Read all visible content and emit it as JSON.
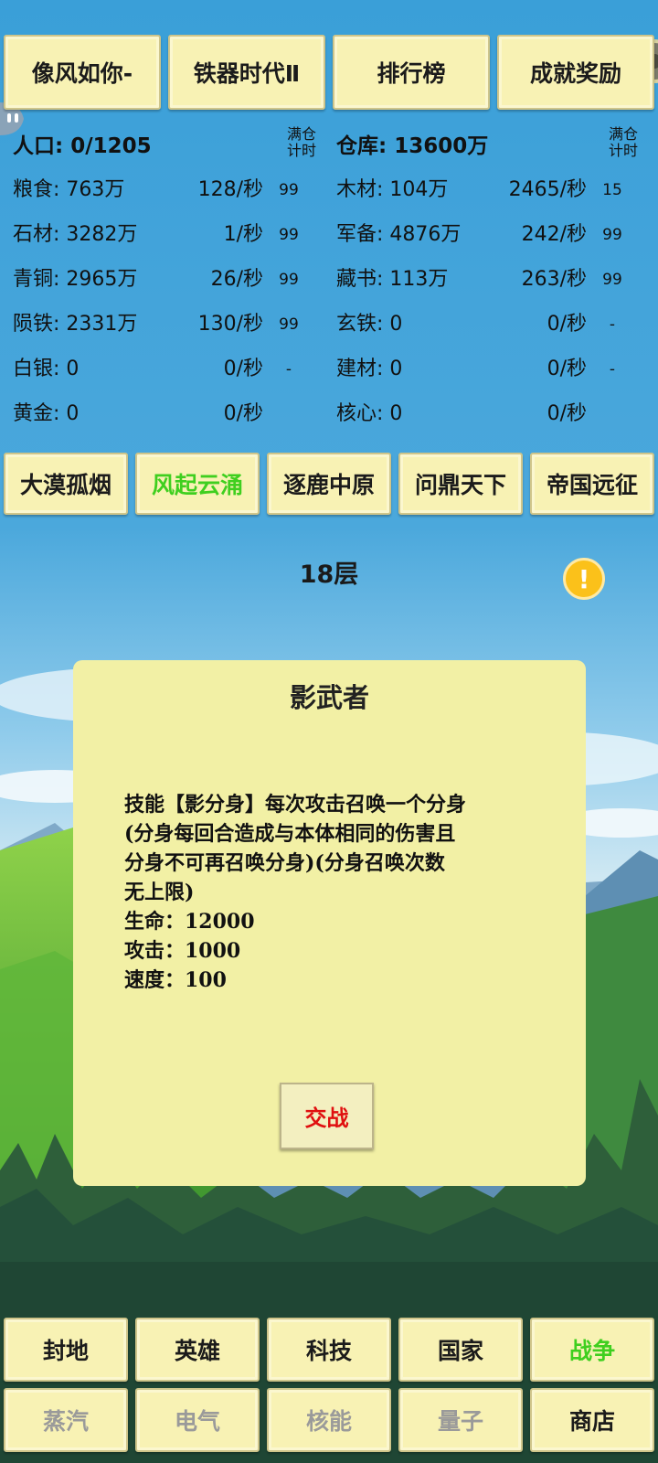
{
  "top_buttons": [
    "像风如你-",
    "铁器时代Ⅱ",
    "排行榜",
    "成就奖励"
  ],
  "resources": {
    "left_header": {
      "label": "人口: 0/1205",
      "full_label_1": "满仓",
      "full_label_2": "计时"
    },
    "right_header": {
      "label": "仓库: 13600万",
      "full_label_1": "满仓",
      "full_label_2": "计时"
    },
    "left": [
      {
        "name": "粮食: 763万",
        "rate": "128/秒",
        "full": "99"
      },
      {
        "name": "石材: 3282万",
        "rate": "1/秒",
        "full": "99"
      },
      {
        "name": "青铜: 2965万",
        "rate": "26/秒",
        "full": "99"
      },
      {
        "name": "陨铁: 2331万",
        "rate": "130/秒",
        "full": "99"
      },
      {
        "name": "白银: 0",
        "rate": "0/秒",
        "full": "-"
      },
      {
        "name": "黄金: 0",
        "rate": "0/秒",
        "full": ""
      }
    ],
    "right": [
      {
        "name": "木材: 104万",
        "rate": "2465/秒",
        "full": "15"
      },
      {
        "name": "军备: 4876万",
        "rate": "242/秒",
        "full": "99"
      },
      {
        "name": "藏书: 113万",
        "rate": "263/秒",
        "full": "99"
      },
      {
        "name": "玄铁: 0",
        "rate": "0/秒",
        "full": "-"
      },
      {
        "name": "建材: 0",
        "rate": "0/秒",
        "full": "-"
      },
      {
        "name": "核心: 0",
        "rate": "0/秒",
        "full": ""
      }
    ]
  },
  "tabs": [
    {
      "label": "大漠孤烟",
      "active": false
    },
    {
      "label": "风起云涌",
      "active": true
    },
    {
      "label": "逐鹿中原",
      "active": false
    },
    {
      "label": "问鼎天下",
      "active": false
    },
    {
      "label": "帝国远征",
      "active": false
    }
  ],
  "floor": "18层",
  "modal": {
    "title": "影武者",
    "desc_lines": [
      "技能【影分身】每次攻击召唤一个分身",
      "(分身每回合造成与本体相同的伤害且",
      "分身不可再召唤分身)(分身召唤次数",
      "无上限)",
      "生命：12000",
      "攻击：1000",
      "速度：100"
    ],
    "fight_label": "交战"
  },
  "nav_row1": [
    {
      "label": "封地",
      "state": "normal"
    },
    {
      "label": "英雄",
      "state": "normal"
    },
    {
      "label": "科技",
      "state": "normal"
    },
    {
      "label": "国家",
      "state": "normal"
    },
    {
      "label": "战争",
      "state": "active"
    }
  ],
  "nav_row2": [
    {
      "label": "蒸汽",
      "state": "disabled"
    },
    {
      "label": "电气",
      "state": "disabled"
    },
    {
      "label": "核能",
      "state": "disabled"
    },
    {
      "label": "量子",
      "state": "disabled"
    },
    {
      "label": "商店",
      "state": "normal"
    }
  ],
  "colors": {
    "accent_green": "#3fcf1f",
    "fight_red": "#e01010",
    "button_bg": "#f8f2b4",
    "modal_bg": "#f2f0a5"
  },
  "icons": {
    "warning": "exclamation-circle-icon",
    "chat": "chat-bubble-icon",
    "float": "floating-ball-icon"
  }
}
